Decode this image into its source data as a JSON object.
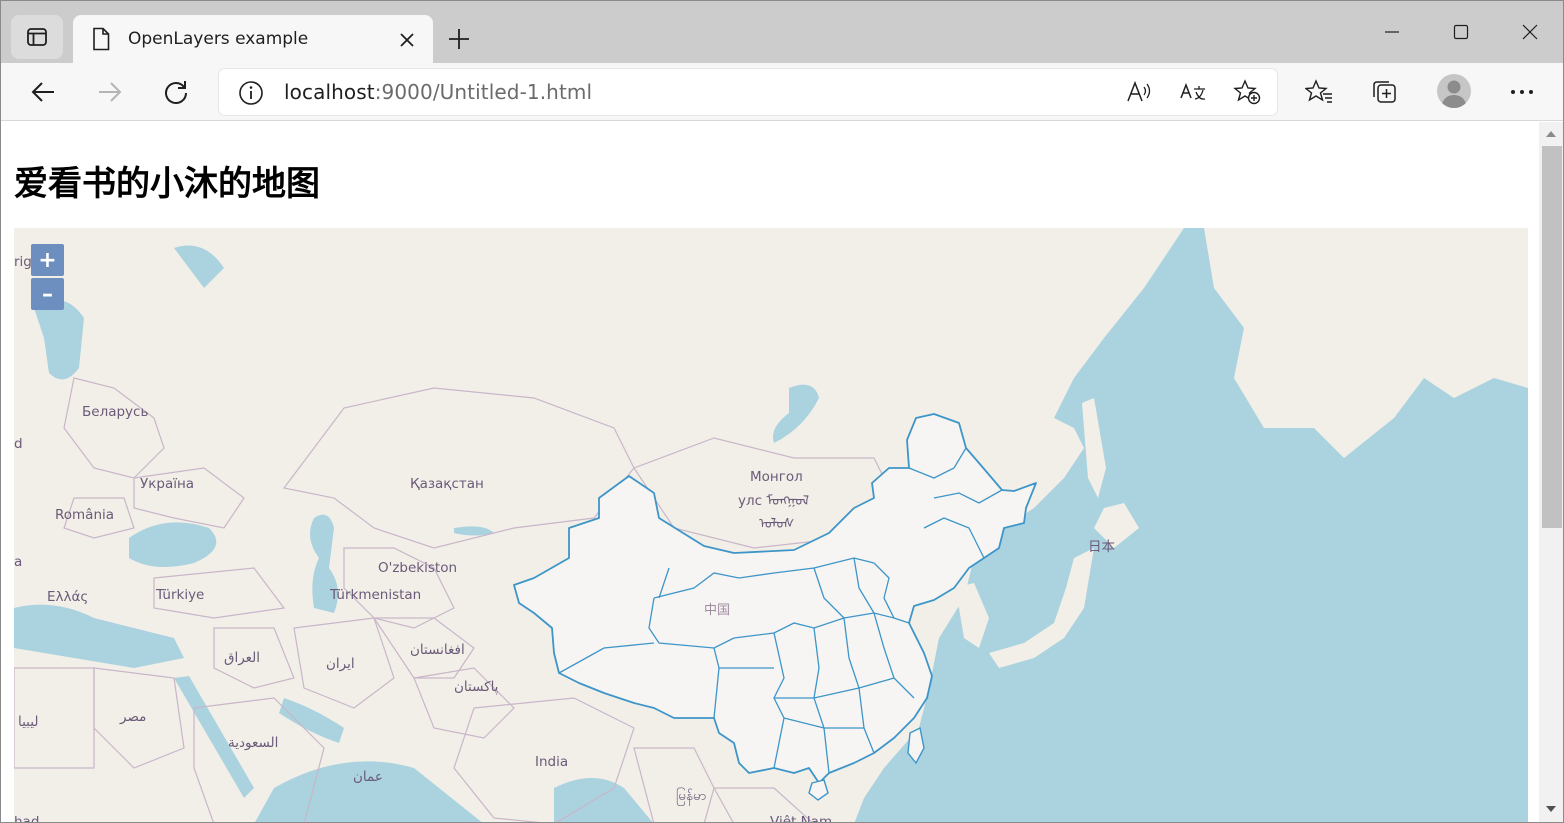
{
  "browser": {
    "tab": {
      "title": "OpenLayers example"
    },
    "address_bar": {
      "host": "localhost",
      "path": ":9000/Untitled-1.html"
    }
  },
  "page": {
    "heading": "爱看书的小沐的地图",
    "zoom": {
      "in_label": "+",
      "out_label": "–"
    },
    "map_labels": {
      "belarus": "Беларусь",
      "ukraine": "Україна",
      "romania": "România",
      "greece": "Ελλάς",
      "turkey": "Türkiye",
      "kazakhstan": "Қазақстан",
      "mongolia_1": "Монгол",
      "mongolia_2": "улс ᠮᠣᠩᠭᠣᠯ",
      "mongolia_3": "ᠤᠯᠤᠰ",
      "uzbekistan": "O'zbekiston",
      "turkmenistan": "Türkmenistan",
      "china": "中国",
      "japan": "日本",
      "iraq": "العراق",
      "iran": "ایران",
      "afghanistan": "افغانستان",
      "pakistan": "پاکستان",
      "libya": "ليبيا",
      "egypt": "مصر",
      "saudi": "السعودية",
      "oman": "عمان",
      "india": "India",
      "myanmar": "မြန်မာ",
      "vietnam": "Việt Nam",
      "edge_left_1": "rig",
      "edge_left_2": "d",
      "edge_left_3": "a",
      "edge_bottom_left": "had"
    }
  },
  "colors": {
    "sea": "#aad3df",
    "land": "#f2efe9",
    "border": "#c9b6c9",
    "china_fill": "#f6f5f3",
    "china_stroke": "#3d95c8",
    "zoom_button": "#6d8fbf"
  }
}
